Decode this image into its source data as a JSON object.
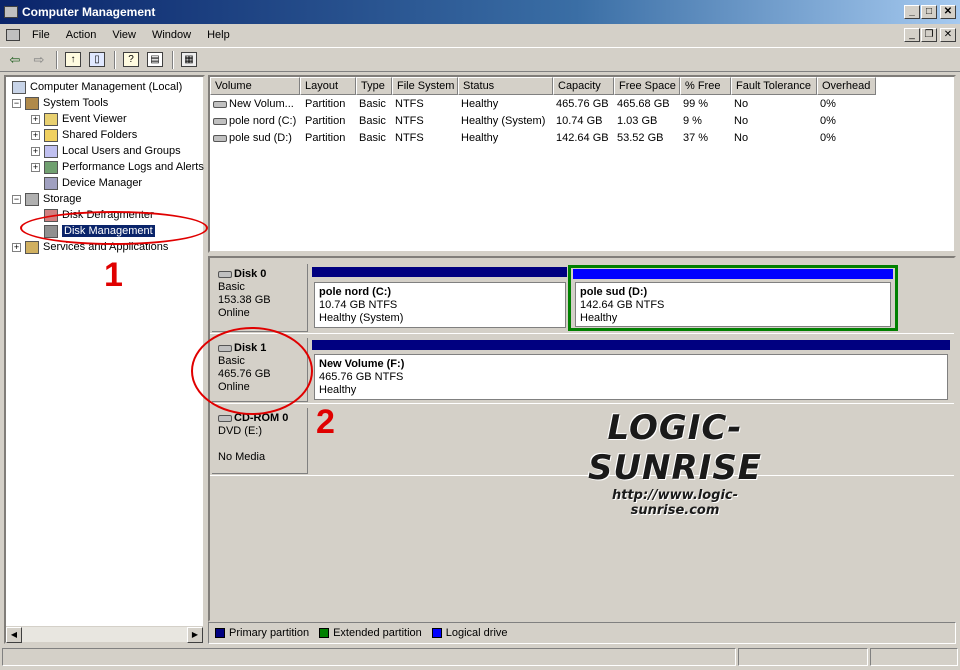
{
  "window": {
    "title": "Computer Management",
    "minimize": "_",
    "maximize": "□",
    "close": "✕",
    "mdi_minimize": "_",
    "mdi_restore": "❐",
    "mdi_close": "✕"
  },
  "menu": [
    "File",
    "Action",
    "View",
    "Window",
    "Help"
  ],
  "toolbar": {
    "back": "⇦",
    "forward": "⇨",
    "up": "↑",
    "showhide": "▯",
    "help": "?",
    "props": "▤",
    "export": "▦"
  },
  "tree": {
    "root": "Computer Management (Local)",
    "system_tools": "System Tools",
    "event_viewer": "Event Viewer",
    "shared_folders": "Shared Folders",
    "local_users": "Local Users and Groups",
    "perf_logs": "Performance Logs and Alerts",
    "device_manager": "Device Manager",
    "storage": "Storage",
    "disk_defrag": "Disk Defragmenter",
    "disk_mgmt": "Disk Management",
    "services": "Services and Applications",
    "collapse": "−",
    "expand": "+"
  },
  "scroll": {
    "left": "◀",
    "right": "▶"
  },
  "volume_list": {
    "columns": [
      "Volume",
      "Layout",
      "Type",
      "File System",
      "Status",
      "Capacity",
      "Free Space",
      "% Free",
      "Fault Tolerance",
      "Overhead"
    ],
    "rows": [
      [
        "New Volum...",
        "Partition",
        "Basic",
        "NTFS",
        "Healthy",
        "465.76 GB",
        "465.68 GB",
        "99 %",
        "No",
        "0%"
      ],
      [
        "pole nord (C:)",
        "Partition",
        "Basic",
        "NTFS",
        "Healthy (System)",
        "10.74 GB",
        "1.03 GB",
        "9 %",
        "No",
        "0%"
      ],
      [
        "pole sud (D:)",
        "Partition",
        "Basic",
        "NTFS",
        "Healthy",
        "142.64 GB",
        "53.52 GB",
        "37 %",
        "No",
        "0%"
      ]
    ]
  },
  "disks": {
    "disk0": {
      "name": "Disk 0",
      "type": "Basic",
      "size": "153.38 GB",
      "status": "Online",
      "p1": {
        "name": "pole nord  (C:)",
        "size": "10.74 GB NTFS",
        "status": "Healthy (System)"
      },
      "p2": {
        "name": "pole sud  (D:)",
        "size": "142.64 GB NTFS",
        "status": "Healthy"
      }
    },
    "disk1": {
      "name": "Disk 1",
      "type": "Basic",
      "size": "465.76 GB",
      "status": "Online",
      "p1": {
        "name": "New Volume  (F:)",
        "size": "465.76 GB NTFS",
        "status": "Healthy"
      }
    },
    "cdrom0": {
      "name": "CD-ROM 0",
      "type": "DVD (E:)",
      "status": "No Media"
    }
  },
  "legend": {
    "primary": "Primary partition",
    "extended": "Extended partition",
    "logical": "Logical drive"
  },
  "colors": {
    "primary": "#000080",
    "extended": "#008000",
    "logical": "#0000ff",
    "annotation": "#e00000"
  },
  "annotations": {
    "n1": "1",
    "n2": "2"
  },
  "watermark": {
    "title": "LOGIC-SUNRISE",
    "url": "http://www.logic-sunrise.com"
  }
}
